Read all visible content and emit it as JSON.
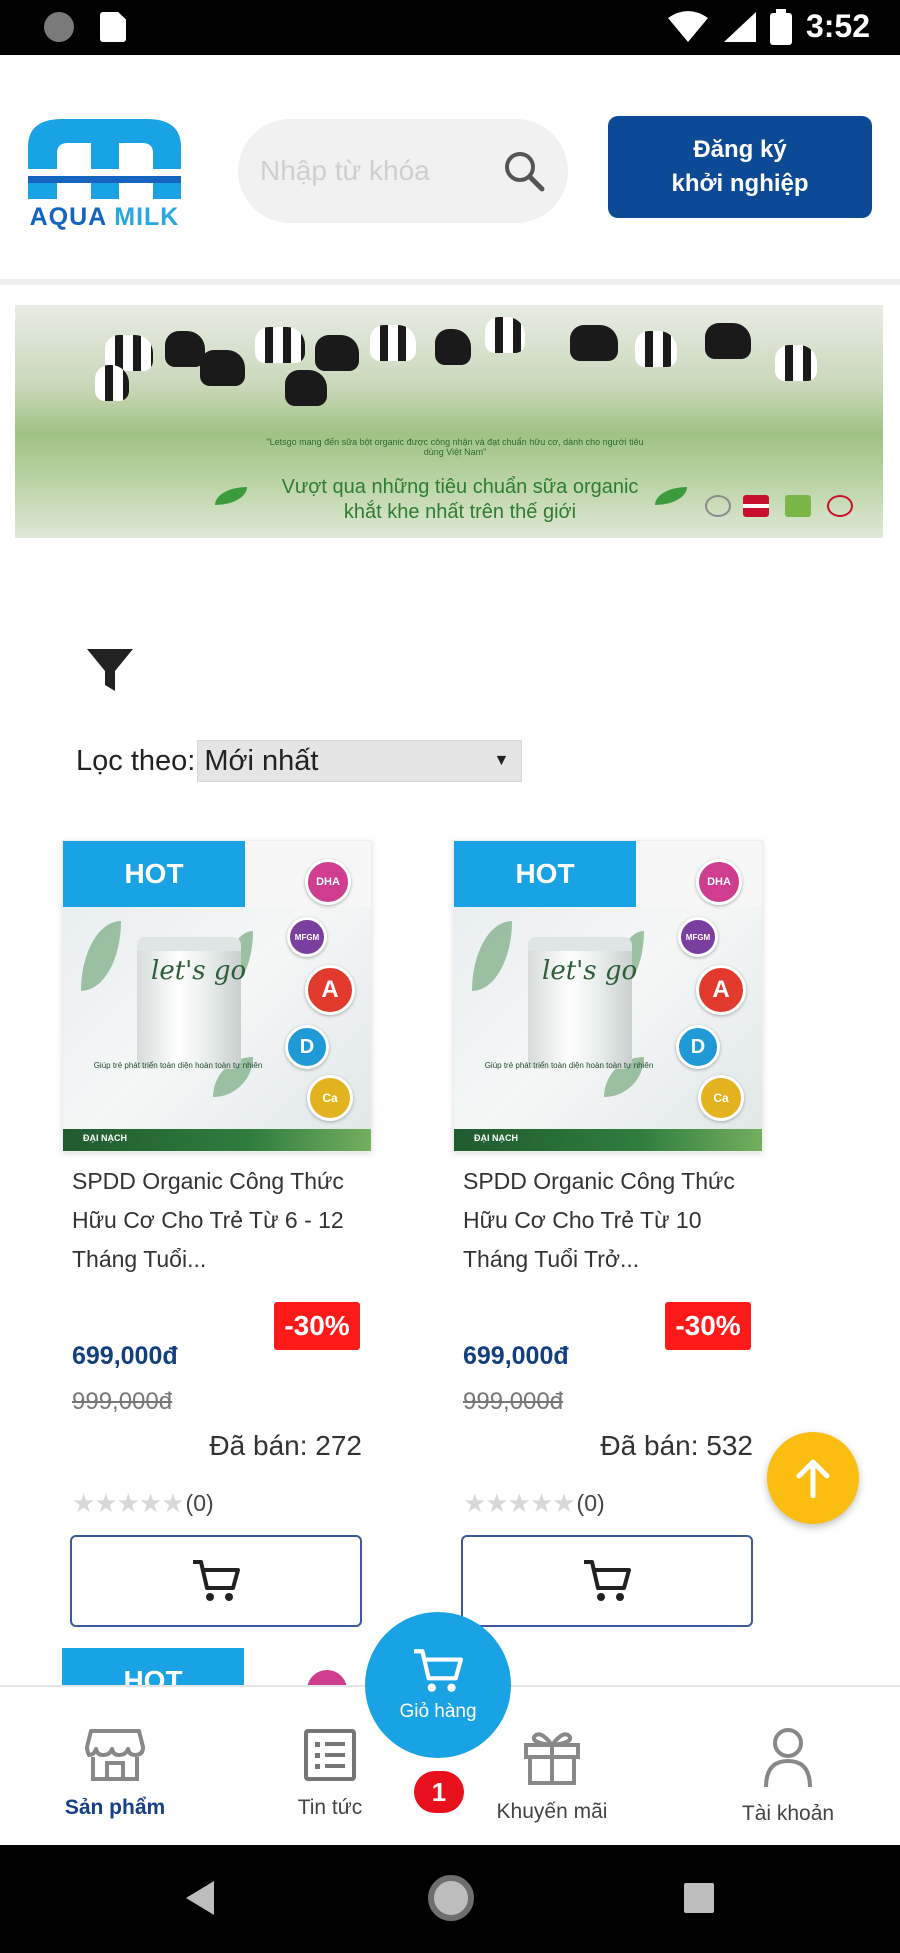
{
  "status_bar": {
    "time": "3:52"
  },
  "header": {
    "logo": {
      "text_left": "AQUA",
      "text_right": "MILK"
    },
    "search": {
      "placeholder": "Nhập từ khóa"
    },
    "register_button": {
      "line1": "Đăng ký",
      "line2": "khởi nghiệp"
    }
  },
  "banner": {
    "quote": "\"Letsgo mang đến sữa bột organic được công nhận và đạt chuẩn hữu cơ, dành cho người tiêu dùng Việt Nam\"",
    "headline_line1": "Vượt qua những tiêu chuẩn sữa organic",
    "headline_line2": "khắt khe nhất trên thế giới"
  },
  "filter": {
    "label": "Lọc theo:",
    "selected": "Mới nhất",
    "caret": "▼"
  },
  "products": [
    {
      "badge": "HOT",
      "name": "SPDD Organic Công Thức Hữu Cơ Cho Trẻ Từ 6 - 12 Tháng Tuổi...",
      "discount": "-30%",
      "price": "699,000đ",
      "old_price": "999,000đ",
      "sold": "Đã bán: 272",
      "stars": "★★★★★",
      "rating_count": "(0)",
      "pack": {
        "can_label": "let's go",
        "caption": "Giúp trẻ phát triển toàn diện hoàn toàn tự nhiên",
        "brand": "ĐẠI NẠCH"
      }
    },
    {
      "badge": "HOT",
      "name": "SPDD Organic Công Thức Hữu Cơ Cho Trẻ Từ 10 Tháng Tuổi Trở...",
      "discount": "-30%",
      "price": "699,000đ",
      "old_price": "999,000đ",
      "sold": "Đã bán: 532",
      "stars": "★★★★★",
      "rating_count": "(0)",
      "pack": {
        "can_label": "let's go",
        "caption": "Giúp trẻ phát triển toàn diện hoàn toàn tự nhiên",
        "brand": "ĐẠI NẠCH"
      }
    }
  ],
  "peek_product": {
    "badge": "HOT"
  },
  "vitamins": [
    "DHA",
    "MFGM",
    "A",
    "D",
    "Ca"
  ],
  "bottom_nav": {
    "items": [
      {
        "label": "Sản phẩm",
        "icon": "store-icon",
        "active": true
      },
      {
        "label": "Tin tức",
        "icon": "news-icon",
        "active": false
      },
      {
        "label": "Khuyến mãi",
        "icon": "gift-icon",
        "active": false
      },
      {
        "label": "Tài khoản",
        "icon": "user-icon",
        "active": false
      }
    ],
    "cart": {
      "label": "Giỏ hàng",
      "badge": "1"
    }
  },
  "colors": {
    "brand_blue": "#0d4a96",
    "accent_cyan": "#1aa3e4",
    "discount_red": "#ff1a1a",
    "scroll_top_yellow": "#fbbd10",
    "price_blue": "#123f80"
  }
}
